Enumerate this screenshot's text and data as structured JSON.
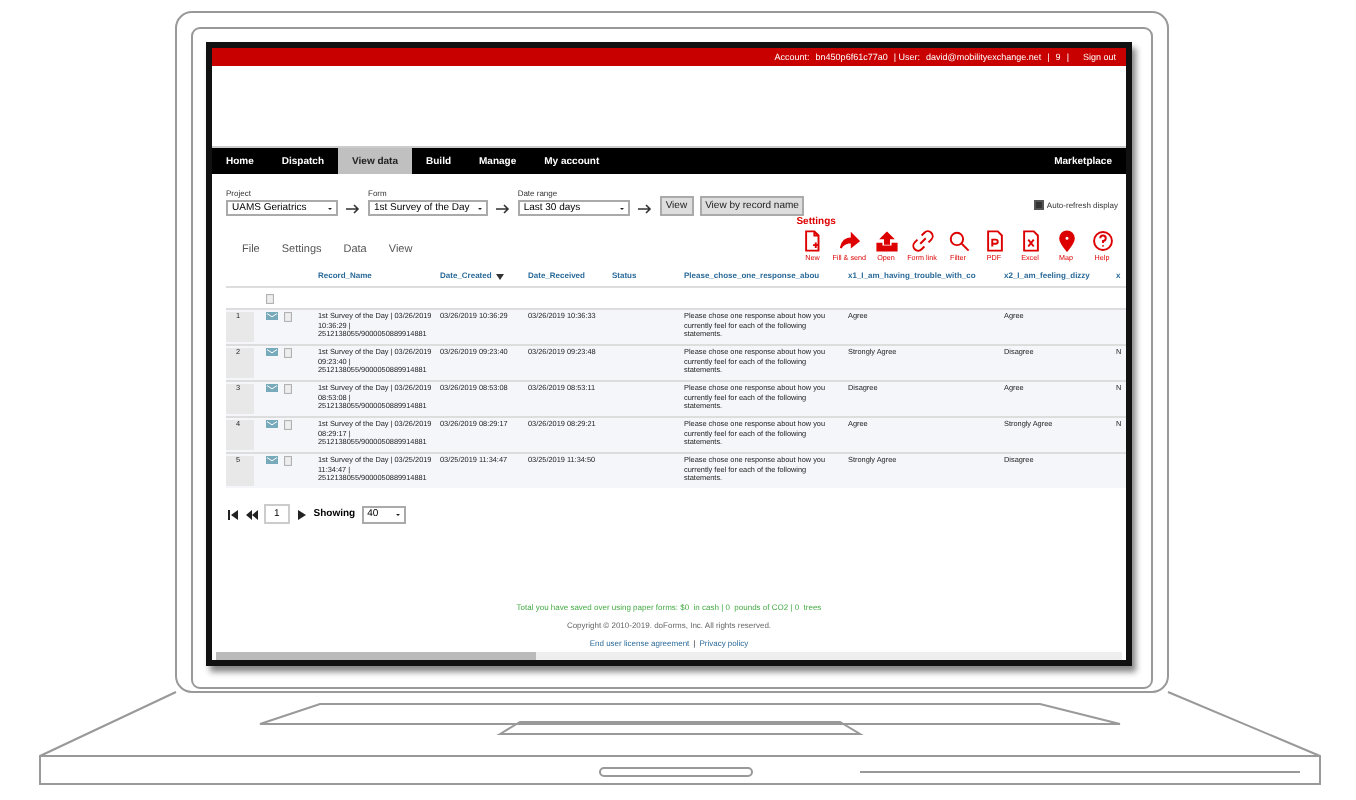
{
  "top_bar": {
    "account_label": "Account:",
    "account": "bn450p6f61c77a0",
    "user_label": "| User:",
    "user": "david@mobilityexchange.net",
    "separators": [
      "|",
      "|"
    ],
    "count": "9",
    "sign_out": "Sign out"
  },
  "nav": {
    "items": [
      {
        "label": "Home",
        "selected": false
      },
      {
        "label": "Dispatch",
        "selected": false
      },
      {
        "label": "View data",
        "selected": true
      },
      {
        "label": "Build",
        "selected": false
      },
      {
        "label": "Manage",
        "selected": false
      },
      {
        "label": "My account",
        "selected": false
      }
    ],
    "right": "Marketplace"
  },
  "filters": [
    {
      "label": "Project",
      "value": "UAMS Geriatrics"
    },
    {
      "label": "Form",
      "value": "1st Survey of the Day"
    },
    {
      "label": "Date range",
      "value": "Last 30 days"
    }
  ],
  "buttons": [
    "View",
    "View by record name"
  ],
  "auto_refresh": {
    "label": "Auto-refresh display",
    "checked": true
  },
  "toolbar": {
    "title": "Settings",
    "items": [
      {
        "kind": "new",
        "label": "New"
      },
      {
        "kind": "send",
        "label": "Fill & send"
      },
      {
        "kind": "open",
        "label": "Open"
      },
      {
        "kind": "link",
        "label": "Form link"
      },
      {
        "kind": "filter",
        "label": "Filter"
      },
      {
        "kind": "pdf",
        "label": "PDF"
      },
      {
        "kind": "excel",
        "label": "Excel"
      },
      {
        "kind": "map",
        "label": "Map"
      },
      {
        "kind": "help",
        "label": "Help"
      }
    ]
  },
  "menu": [
    "File",
    "Settings",
    "Data",
    "View"
  ],
  "table": {
    "columns": [
      {
        "label": "Record_Name",
        "sorted": false
      },
      {
        "label": "Date_Created",
        "sorted": true
      },
      {
        "label": "Date_Received",
        "sorted": false
      },
      {
        "label": "Status",
        "sorted": false
      },
      {
        "label": "Please_chose_one_response_abou",
        "sorted": false
      },
      {
        "label": "x1_I_am_having_trouble_with_co",
        "sorted": false
      },
      {
        "label": "x2_I_am_feeling_dizzy",
        "sorted": false
      },
      {
        "label": "x",
        "sorted": false
      }
    ],
    "rows": [
      {
        "number": "1",
        "cells": [
          "1st Survey of the Day | 03/26/2019 10:36:29 | 2512138055/9000050889914881",
          "03/26/2019 10:36:29",
          "03/26/2019 10:36:33",
          "",
          "Please chose one response about how you currently feel for each of the following statements.",
          "Agree",
          "Agree",
          ""
        ]
      },
      {
        "number": "2",
        "cells": [
          "1st Survey of the Day | 03/26/2019 09:23:40 | 2512138055/9000050889914881",
          "03/26/2019 09:23:40",
          "03/26/2019 09:23:48",
          "",
          "Please chose one response about how you currently feel for each of the following statements.",
          "Strongly Agree",
          "Disagree",
          "N"
        ]
      },
      {
        "number": "3",
        "cells": [
          "1st Survey of the Day | 03/26/2019 08:53:08 | 2512138055/9000050889914881",
          "03/26/2019 08:53:08",
          "03/26/2019 08:53:11",
          "",
          "Please chose one response about how you currently feel for each of the following statements.",
          "Disagree",
          "Agree",
          "N"
        ]
      },
      {
        "number": "4",
        "cells": [
          "1st Survey of the Day | 03/26/2019 08:29:17 | 2512138055/9000050889914881",
          "03/26/2019 08:29:17",
          "03/26/2019 08:29:21",
          "",
          "Please chose one response about how you currently feel for each of the following statements.",
          "Agree",
          "Strongly Agree",
          "N"
        ]
      },
      {
        "number": "5",
        "cells": [
          "1st Survey of the Day | 03/25/2019 11:34:47 | 2512138055/9000050889914881",
          "03/25/2019 11:34:47",
          "03/25/2019 11:34:50",
          "",
          "Please chose one response about how you currently feel for each of the following statements.",
          "Strongly Agree",
          "Disagree",
          ""
        ]
      }
    ]
  },
  "pager": {
    "page": "1",
    "showing_label": "Showing",
    "page_size": "40"
  },
  "footer": {
    "savings": "Total you have saved over using paper forms: $0  in cash | 0  pounds of CO2 | 0  trees",
    "copyright": "Copyright © 2010-2019. doForms, Inc. All rights reserved.",
    "links": [
      "End user license agreement",
      "Privacy policy"
    ],
    "link_separator": "|"
  }
}
